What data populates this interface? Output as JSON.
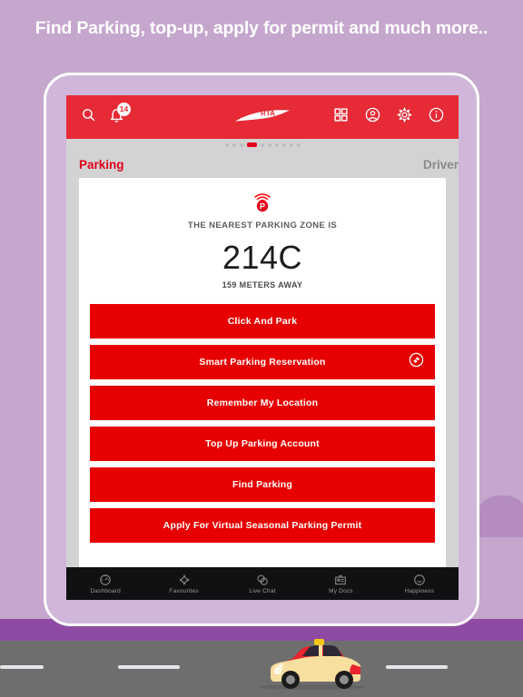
{
  "headline": "Find Parking, top-up, apply for permit and much more..",
  "colors": {
    "background": "#c5a6cd",
    "nav_red": "#e62a36",
    "button_red": "#e60000",
    "accent_red": "#e3001b",
    "tabbar": "#111013",
    "screen_grey": "#d3d3d3",
    "road": "#6e6e6e",
    "purple_strip": "#8e4ba3",
    "car_body": "#f7dfa0",
    "car_roof": "#e8242e"
  },
  "navbar": {
    "search_icon": "search-icon",
    "notifications_icon": "bell-icon",
    "notifications_count": "14",
    "logo_text": "RTA",
    "grid_icon": "grid-icon",
    "profile_icon": "profile-icon",
    "settings_icon": "gear-icon",
    "info_icon": "info-icon"
  },
  "pager": {
    "total": 10,
    "active_index": 3
  },
  "tabs": [
    {
      "label": "Parking",
      "active": true
    },
    {
      "label": "Driver",
      "active": false
    }
  ],
  "parking_card": {
    "zone_icon": "parking-signal-icon",
    "label": "THE NEAREST PARKING ZONE IS",
    "zone_code": "214C",
    "distance": "159 METERS AWAY"
  },
  "actions": [
    {
      "label": "Click And Park",
      "icon": null
    },
    {
      "label": "Smart Parking Reservation",
      "icon": "tag-icon"
    },
    {
      "label": "Remember My Location",
      "icon": null
    },
    {
      "label": "Top Up Parking Account",
      "icon": null
    },
    {
      "label": "Find Parking",
      "icon": null
    },
    {
      "label": "Apply For Virtual Seasonal Parking Permit",
      "icon": null
    }
  ],
  "bottom_tabs": [
    {
      "label": "Dashboard",
      "icon": "gauge-icon"
    },
    {
      "label": "Favourites",
      "icon": "sparkle-icon"
    },
    {
      "label": "Live Chat",
      "icon": "chat-bubbles-icon"
    },
    {
      "label": "My Docs",
      "icon": "id-card-icon"
    },
    {
      "label": "Happiness",
      "icon": "smiley-icon"
    }
  ]
}
